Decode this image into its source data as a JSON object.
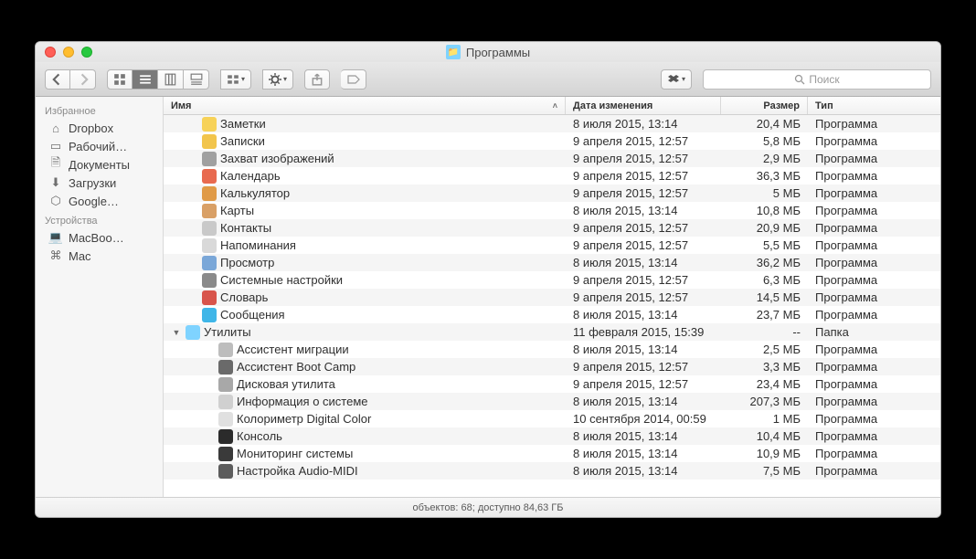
{
  "window": {
    "title": "Программы"
  },
  "search": {
    "placeholder": "Поиск"
  },
  "sidebar": {
    "sections": [
      {
        "title": "Избранное",
        "items": [
          {
            "id": "dropbox",
            "label": "Dropbox",
            "glyph": "⌂"
          },
          {
            "id": "desktop",
            "label": "Рабочий…",
            "glyph": "▭"
          },
          {
            "id": "documents",
            "label": "Документы",
            "glyph": "🗎"
          },
          {
            "id": "downloads",
            "label": "Загрузки",
            "glyph": "⬇"
          },
          {
            "id": "googledrive",
            "label": "Google…",
            "glyph": "⬡"
          }
        ]
      },
      {
        "title": "Устройства",
        "items": [
          {
            "id": "macbook",
            "label": "MacBoo…",
            "glyph": "💻"
          },
          {
            "id": "mac",
            "label": "Mac",
            "glyph": "⌘"
          }
        ]
      }
    ]
  },
  "columns": {
    "name": "Имя",
    "date": "Дата изменения",
    "size": "Размер",
    "kind": "Тип"
  },
  "rows": [
    {
      "indent": 1,
      "disclosure": "",
      "icon_bg": "#f7d258",
      "name": "Заметки",
      "date": "8 июля 2015, 13:14",
      "size": "20,4 МБ",
      "kind": "Программа"
    },
    {
      "indent": 1,
      "disclosure": "",
      "icon_bg": "#f2c54c",
      "name": "Записки",
      "date": "9 апреля 2015, 12:57",
      "size": "5,8 МБ",
      "kind": "Программа"
    },
    {
      "indent": 1,
      "disclosure": "",
      "icon_bg": "#a0a0a0",
      "name": "Захват изображений",
      "date": "9 апреля 2015, 12:57",
      "size": "2,9 МБ",
      "kind": "Программа"
    },
    {
      "indent": 1,
      "disclosure": "",
      "icon_bg": "#e86a4f",
      "name": "Календарь",
      "date": "9 апреля 2015, 12:57",
      "size": "36,3 МБ",
      "kind": "Программа"
    },
    {
      "indent": 1,
      "disclosure": "",
      "icon_bg": "#e09a46",
      "name": "Калькулятор",
      "date": "9 апреля 2015, 12:57",
      "size": "5 МБ",
      "kind": "Программа"
    },
    {
      "indent": 1,
      "disclosure": "",
      "icon_bg": "#d9a066",
      "name": "Карты",
      "date": "8 июля 2015, 13:14",
      "size": "10,8 МБ",
      "kind": "Программа"
    },
    {
      "indent": 1,
      "disclosure": "",
      "icon_bg": "#c9c9c9",
      "name": "Контакты",
      "date": "9 апреля 2015, 12:57",
      "size": "20,9 МБ",
      "kind": "Программа"
    },
    {
      "indent": 1,
      "disclosure": "",
      "icon_bg": "#d9d9d9",
      "name": "Напоминания",
      "date": "9 апреля 2015, 12:57",
      "size": "5,5 МБ",
      "kind": "Программа"
    },
    {
      "indent": 1,
      "disclosure": "",
      "icon_bg": "#7aa7d8",
      "name": "Просмотр",
      "date": "8 июля 2015, 13:14",
      "size": "36,2 МБ",
      "kind": "Программа"
    },
    {
      "indent": 1,
      "disclosure": "",
      "icon_bg": "#8a8a8a",
      "name": "Системные настройки",
      "date": "9 апреля 2015, 12:57",
      "size": "6,3 МБ",
      "kind": "Программа"
    },
    {
      "indent": 1,
      "disclosure": "",
      "icon_bg": "#d8544b",
      "name": "Словарь",
      "date": "9 апреля 2015, 12:57",
      "size": "14,5 МБ",
      "kind": "Программа"
    },
    {
      "indent": 1,
      "disclosure": "",
      "icon_bg": "#3fb6e8",
      "name": "Сообщения",
      "date": "8 июля 2015, 13:14",
      "size": "23,7 МБ",
      "kind": "Программа"
    },
    {
      "indent": 0,
      "disclosure": "▼",
      "icon_bg": "#7fd3ff",
      "name": "Утилиты",
      "date": "11 февраля 2015, 15:39",
      "size": "--",
      "kind": "Папка"
    },
    {
      "indent": 2,
      "disclosure": "",
      "icon_bg": "#bdbdbd",
      "name": "Ассистент миграции",
      "date": "8 июля 2015, 13:14",
      "size": "2,5 МБ",
      "kind": "Программа"
    },
    {
      "indent": 2,
      "disclosure": "",
      "icon_bg": "#6a6a6a",
      "name": "Ассистент Boot Camp",
      "date": "9 апреля 2015, 12:57",
      "size": "3,3 МБ",
      "kind": "Программа"
    },
    {
      "indent": 2,
      "disclosure": "",
      "icon_bg": "#a8a8a8",
      "name": "Дисковая утилита",
      "date": "9 апреля 2015, 12:57",
      "size": "23,4 МБ",
      "kind": "Программа"
    },
    {
      "indent": 2,
      "disclosure": "",
      "icon_bg": "#d0d0d0",
      "name": "Информация о системе",
      "date": "8 июля 2015, 13:14",
      "size": "207,3 МБ",
      "kind": "Программа"
    },
    {
      "indent": 2,
      "disclosure": "",
      "icon_bg": "#e0e0e0",
      "name": "Колориметр Digital Color",
      "date": "10 сентября 2014, 00:59",
      "size": "1 МБ",
      "kind": "Программа"
    },
    {
      "indent": 2,
      "disclosure": "",
      "icon_bg": "#2b2b2b",
      "name": "Консоль",
      "date": "8 июля 2015, 13:14",
      "size": "10,4 МБ",
      "kind": "Программа"
    },
    {
      "indent": 2,
      "disclosure": "",
      "icon_bg": "#3a3a3a",
      "name": "Мониторинг системы",
      "date": "8 июля 2015, 13:14",
      "size": "10,9 МБ",
      "kind": "Программа"
    },
    {
      "indent": 2,
      "disclosure": "",
      "icon_bg": "#5c5c5c",
      "name": "Настройка Audio-MIDI",
      "date": "8 июля 2015, 13:14",
      "size": "7,5 МБ",
      "kind": "Программа"
    }
  ],
  "status": "объектов: 68; доступно 84,63 ГБ"
}
